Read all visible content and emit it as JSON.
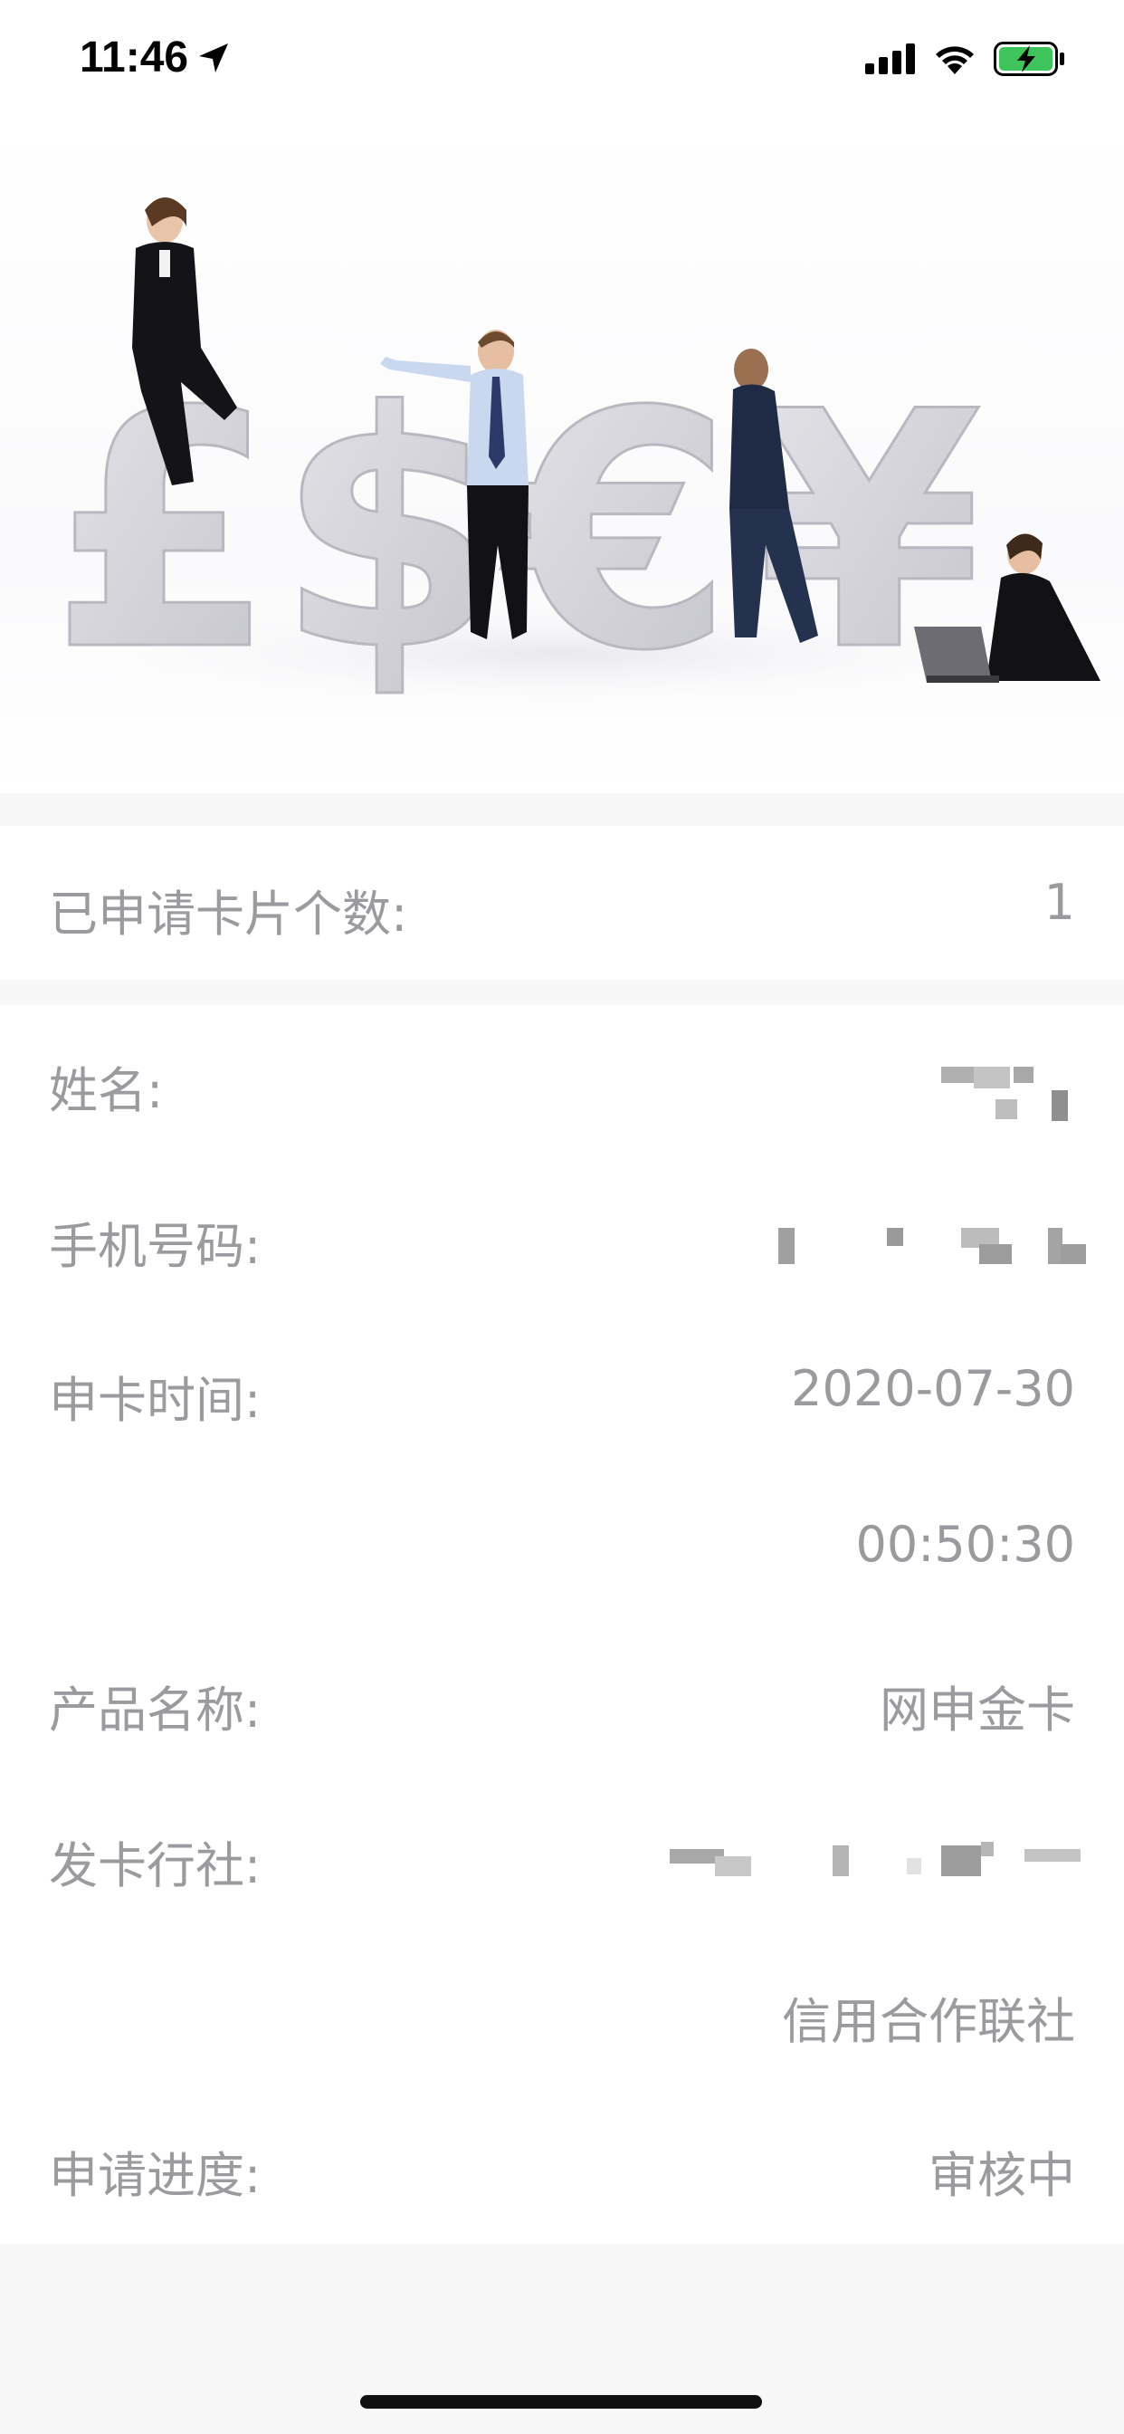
{
  "status_bar": {
    "time": "11:46",
    "icons": [
      "location-arrow-icon",
      "cellular-signal-icon",
      "wifi-icon",
      "battery-charging-icon"
    ],
    "battery_color": "#3ec45a"
  },
  "banner": {
    "symbols": [
      "£",
      "$",
      "€",
      "¥"
    ],
    "symbol_color": "#d9d9de"
  },
  "summary": {
    "applied_cards_label": "已申请卡片个数:",
    "applied_cards_value": "1"
  },
  "details": {
    "name_label": "姓名:",
    "phone_label": "手机号码:",
    "apply_time_label": "申卡时间:",
    "apply_date": "2020-07-30",
    "apply_clock": "00:50:30",
    "product_label": "产品名称:",
    "product_value": "网申金卡",
    "issuer_label": "发卡行社:",
    "issuer_value_line2": "信用合作联社",
    "progress_label": "申请进度:",
    "progress_value": "审核中"
  },
  "colors": {
    "text_gray": "#9a9a9f",
    "page_bg": "#f7f7f8"
  }
}
